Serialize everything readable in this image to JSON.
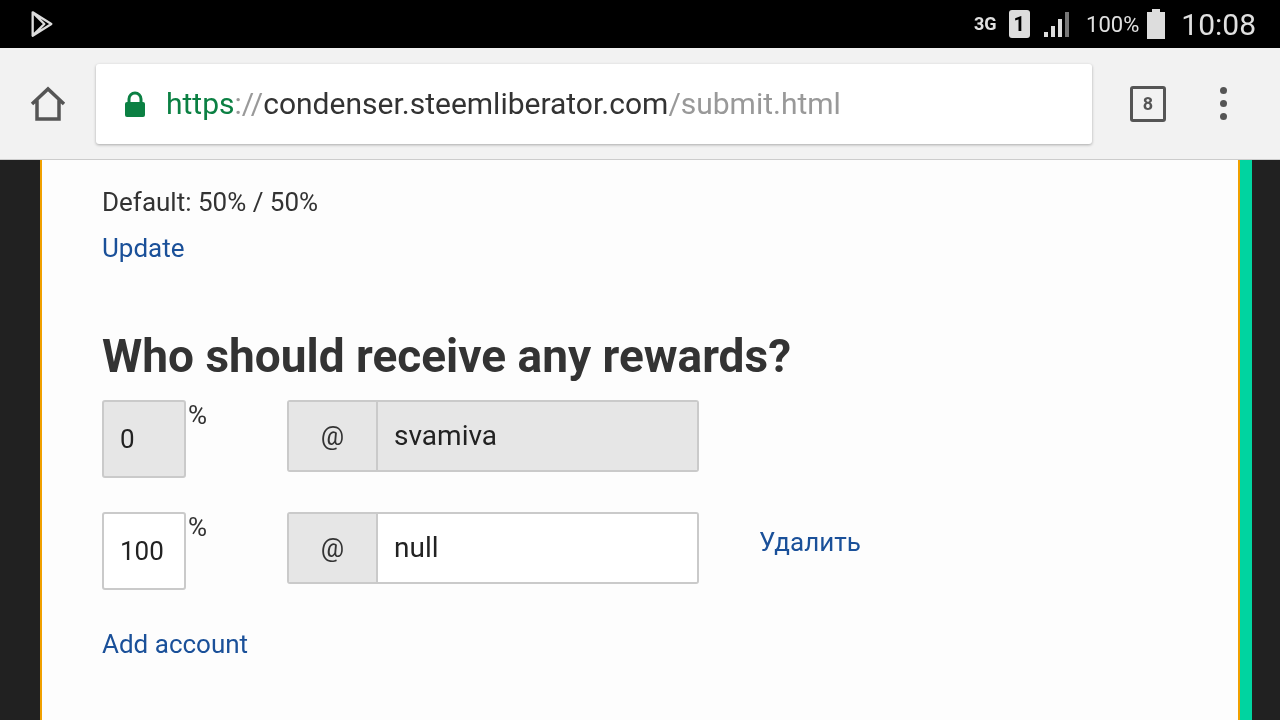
{
  "status_bar": {
    "network": "3G",
    "sim": "1",
    "battery": "100%",
    "time": "10:08"
  },
  "browser": {
    "url": {
      "scheme": "https",
      "separator": "://",
      "host": "condenser.steemliberator.com",
      "path": "/submit.html"
    },
    "tab_count": "8"
  },
  "form": {
    "default_text": "Default: 50% / 50%",
    "update_link": "Update",
    "heading": "Who should receive any rewards?",
    "beneficiaries": [
      {
        "percent": "0",
        "percent_sign": "%",
        "at": "@",
        "account": "svamiva",
        "disabled": true
      },
      {
        "percent": "100",
        "percent_sign": "%",
        "at": "@",
        "account": "null",
        "disabled": false,
        "remove": "Удалить"
      }
    ],
    "add_link": "Add account"
  }
}
